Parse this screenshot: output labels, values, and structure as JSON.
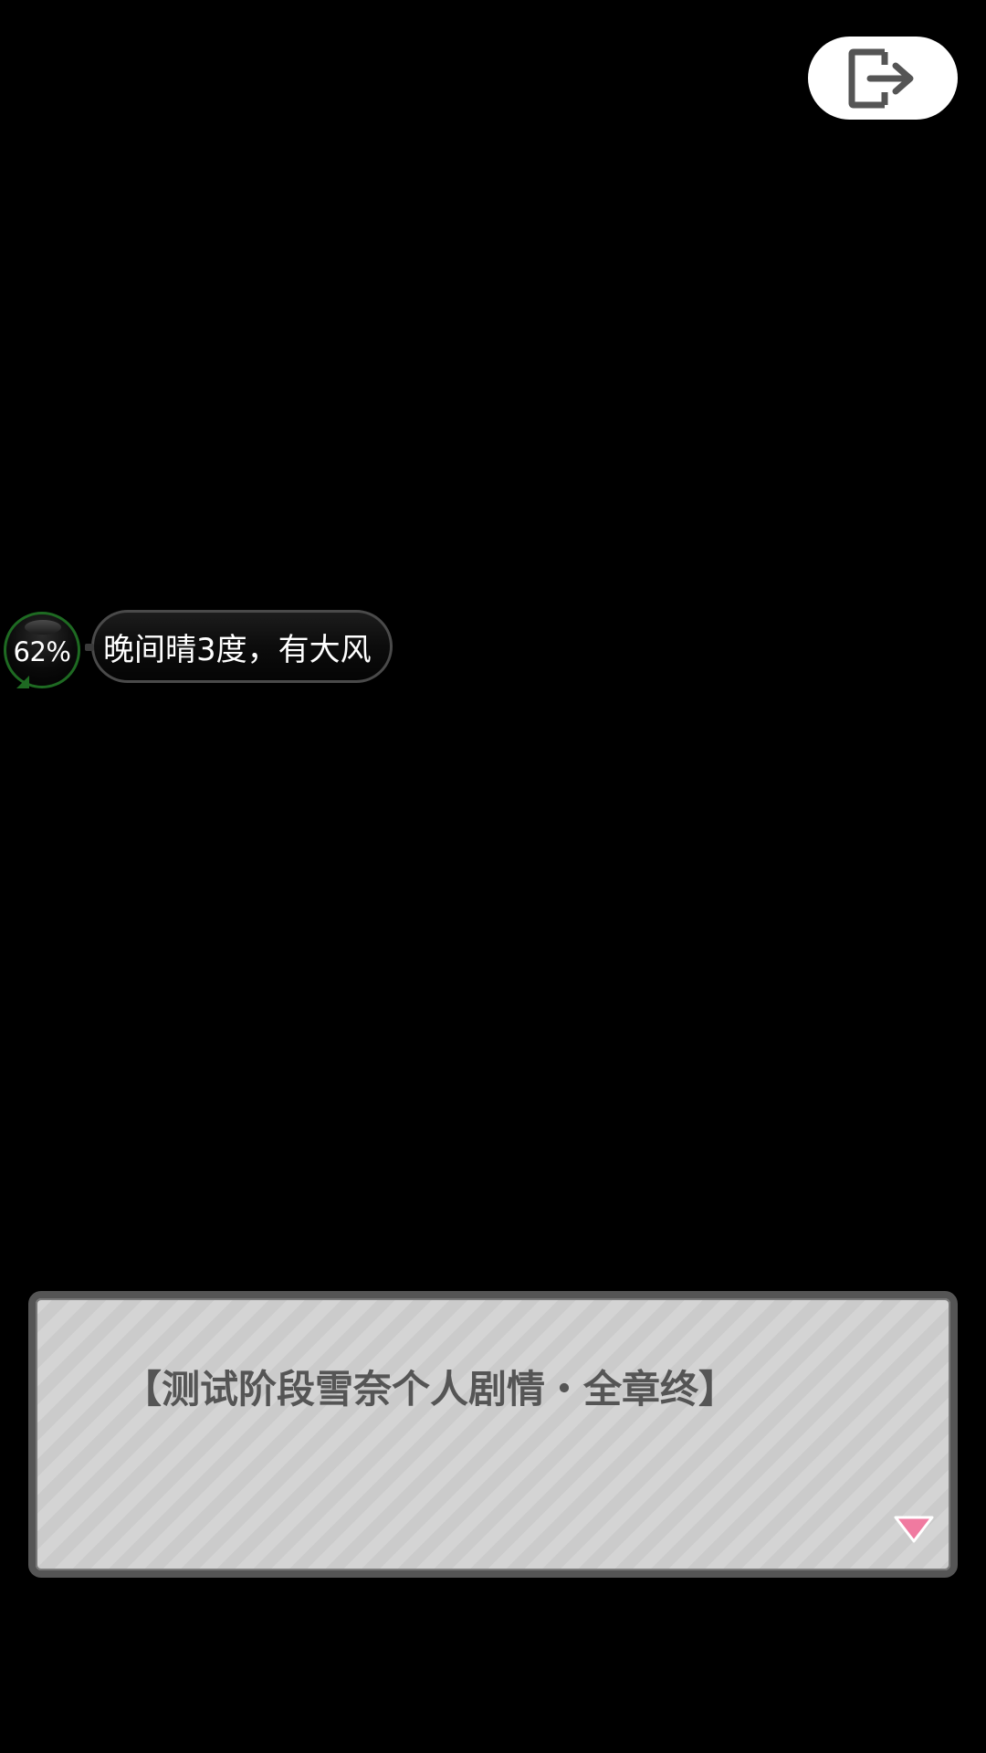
{
  "exit_button": {
    "icon": "exit-icon"
  },
  "weather": {
    "percent": "62%",
    "text": "晚间晴3度，有大风"
  },
  "dialogue": {
    "text": "【测试阶段雪奈个人剧情・全章终】",
    "next_icon": "next-triangle-icon"
  },
  "colors": {
    "background": "#000000",
    "dialogue_bg": "#cfcfcf",
    "dialogue_border": "#555555",
    "dialogue_text": "#555555",
    "ring": "#1e6a22",
    "next_indicator": "#f07aa0"
  }
}
